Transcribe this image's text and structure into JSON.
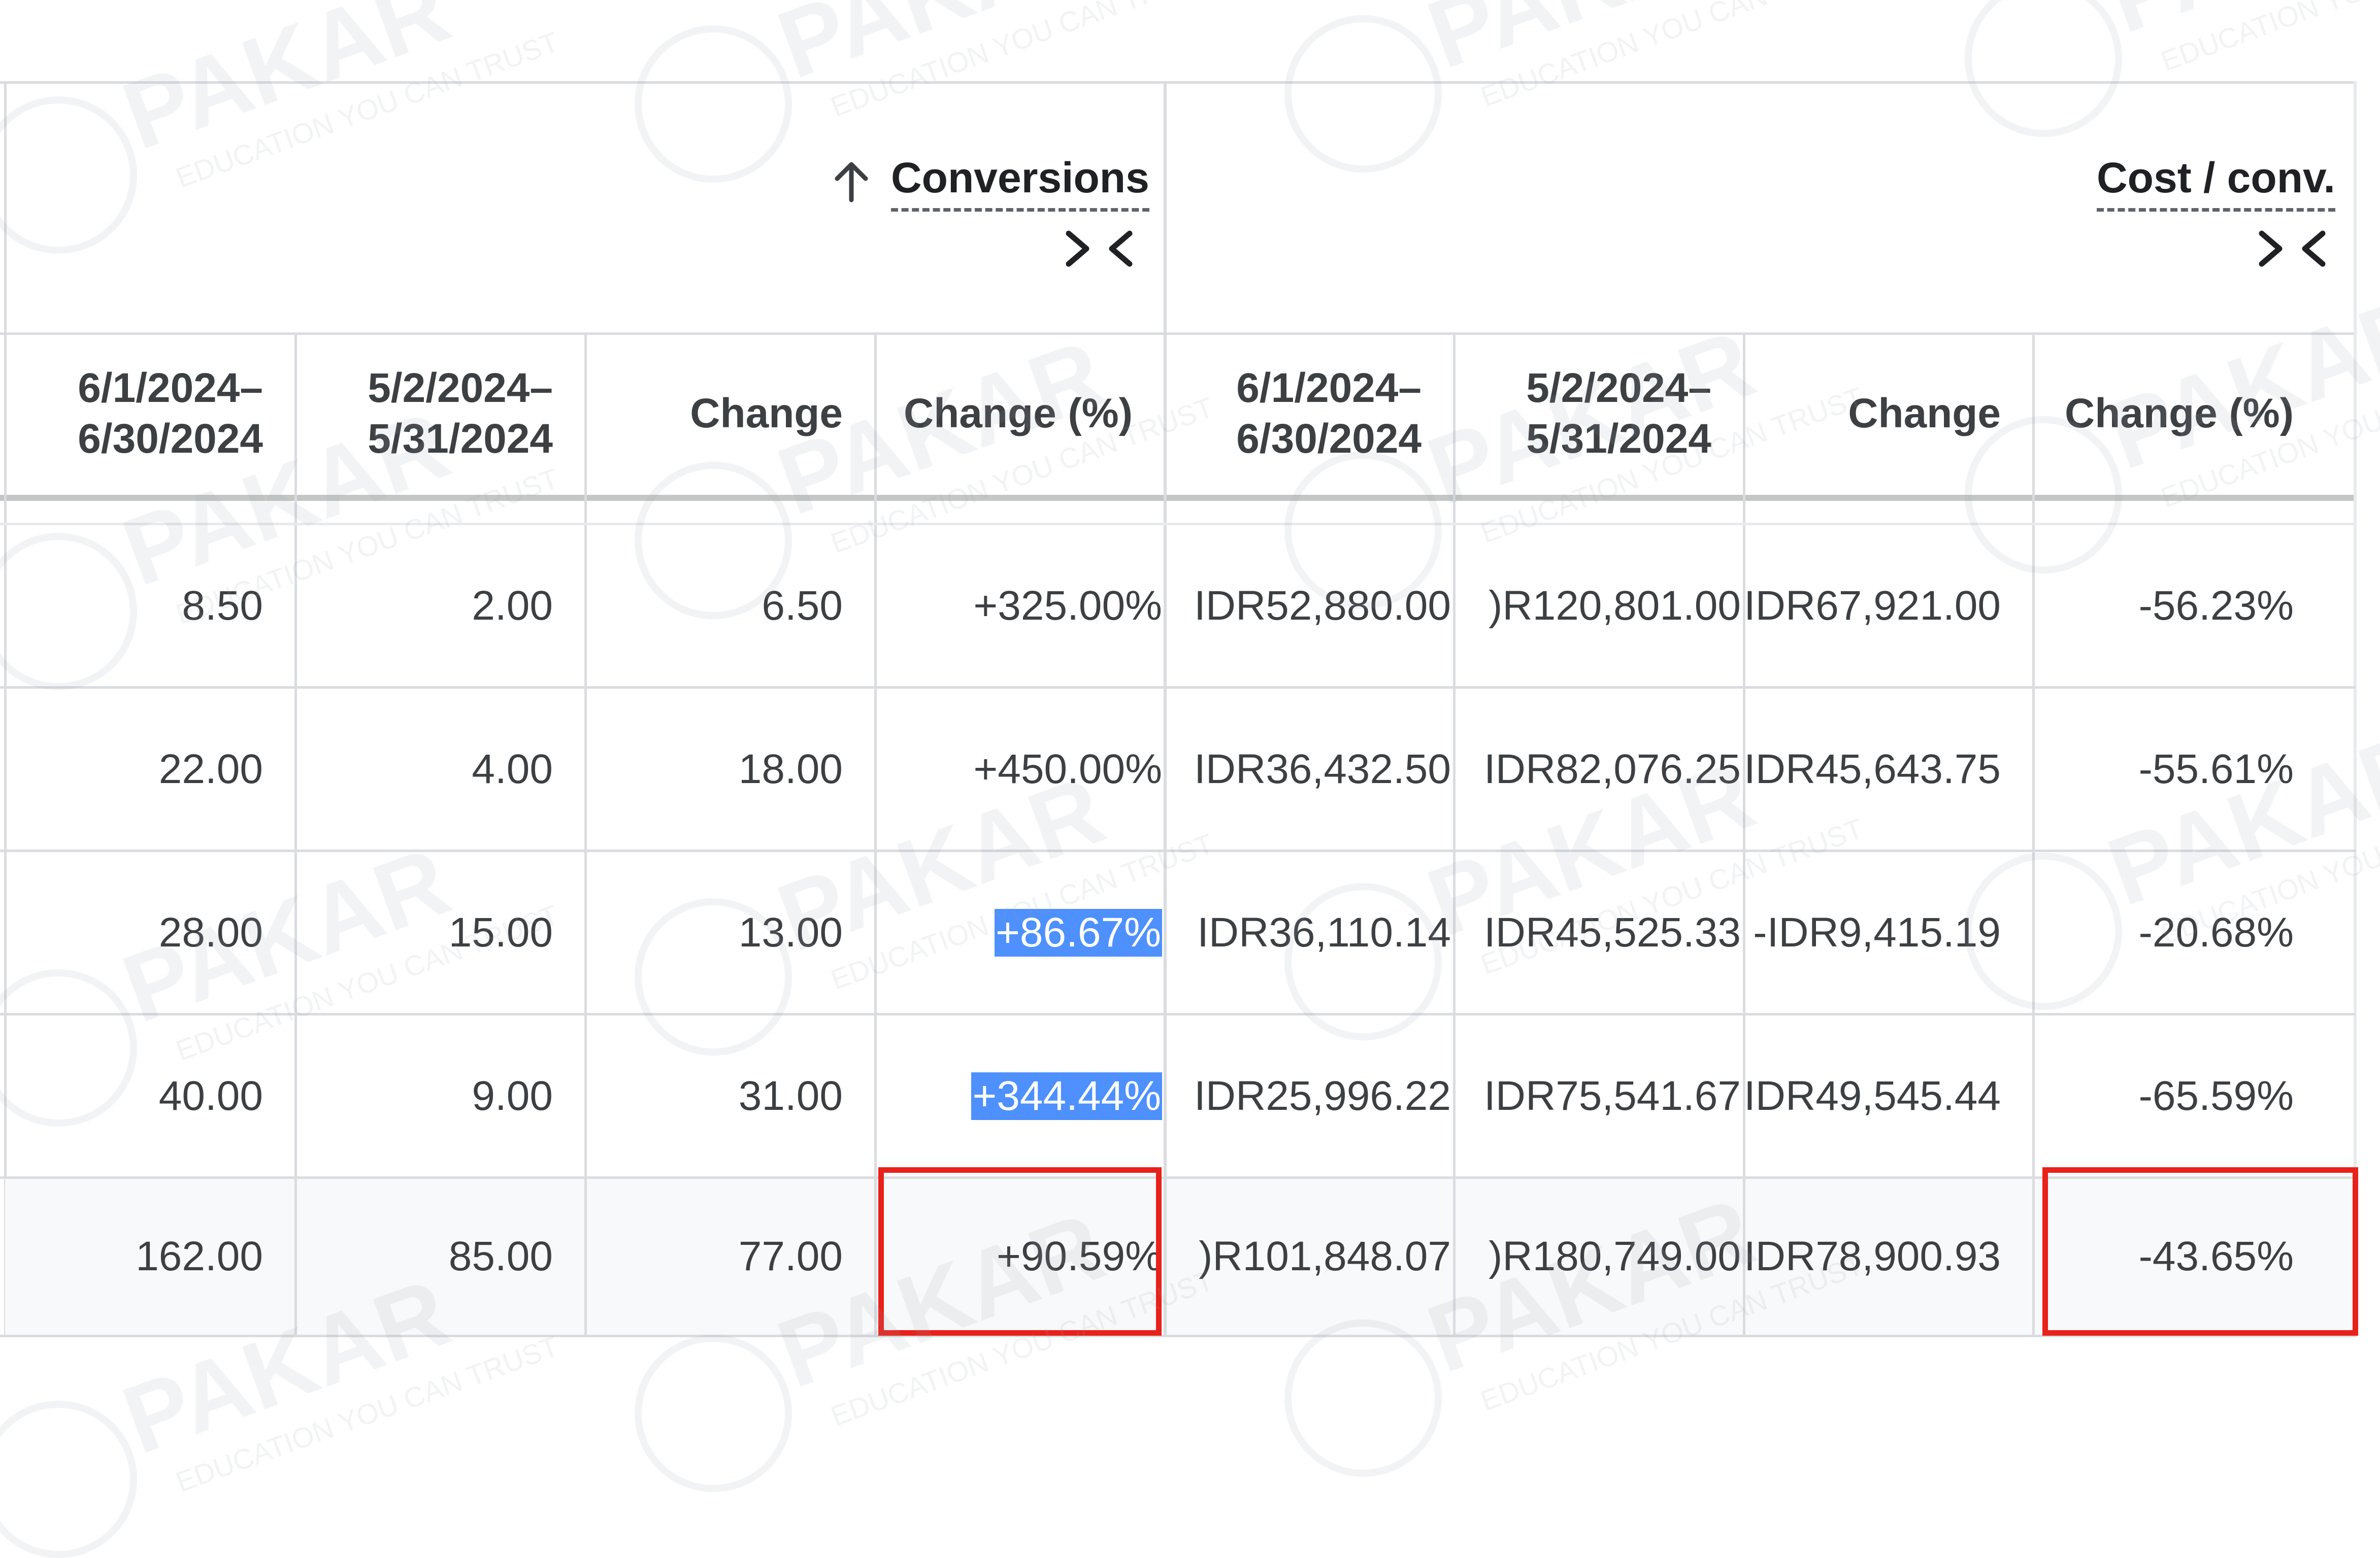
{
  "groups": {
    "conversions": {
      "title": "Conversions"
    },
    "cost_per_conv": {
      "title": "Cost / conv."
    }
  },
  "columns": [
    "6/1/2024–\n6/30/2024",
    "5/2/2024–\n5/31/2024",
    "Change",
    "Change (%)",
    "6/1/2024–\n6/30/2024",
    "5/2/2024–\n5/31/2024",
    "Change",
    "Change (%)"
  ],
  "rows": [
    [
      "8.50",
      "2.00",
      "6.50",
      "+325.00%",
      "IDR52,880.00",
      ")R120,801.00",
      "IDR67,921.00",
      "-56.23%"
    ],
    [
      "22.00",
      "4.00",
      "18.00",
      "+450.00%",
      "IDR36,432.50",
      "IDR82,076.25",
      "IDR45,643.75",
      "-55.61%"
    ],
    [
      "28.00",
      "15.00",
      "13.00",
      "+86.67%",
      "IDR36,110.14",
      "IDR45,525.33",
      "-IDR9,415.19",
      "-20.68%"
    ],
    [
      "40.00",
      "9.00",
      "31.00",
      "+344.44%",
      "IDR25,996.22",
      "IDR75,541.67",
      "IDR49,545.44",
      "-65.59%"
    ]
  ],
  "total_row": [
    "162.00",
    "85.00",
    "77.00",
    "+90.59%",
    ")R101,848.07",
    ")R180,749.00",
    "IDR78,900.93",
    "-43.65%"
  ],
  "highlighted_cells": [
    [
      2,
      3
    ],
    [
      3,
      3
    ]
  ],
  "colors": {
    "highlight": "#4d90fe",
    "annotation_box": "#e8211a",
    "total_row_bg": "#f8f9fa",
    "grid": "#dadce0",
    "text": "#3c4043"
  },
  "watermark": {
    "word": "PAKAR",
    "tagline": "EDUCATION YOU CAN TRUST",
    "logo": "pakar-logo-icon"
  },
  "icons": {
    "sort": "arrow-up-icon",
    "collapse": "collapse-columns-icon"
  }
}
